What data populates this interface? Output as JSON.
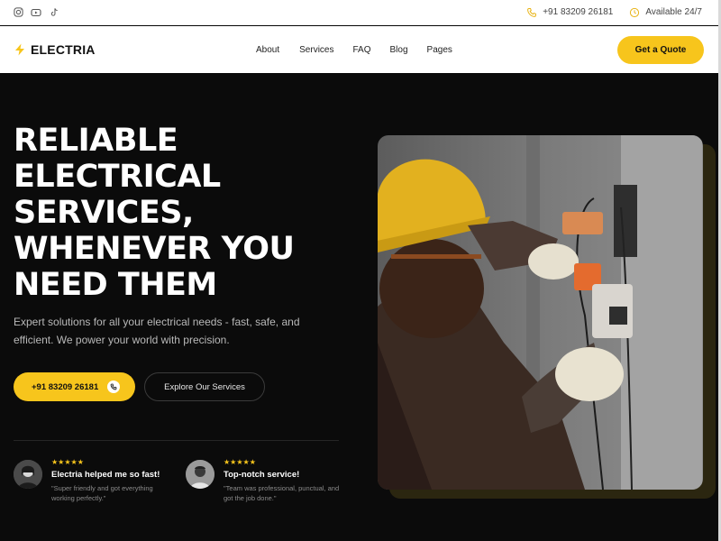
{
  "topbar": {
    "socials": [
      "instagram-icon",
      "youtube-icon",
      "tiktok-icon"
    ],
    "phone": "+91 83209 26181",
    "availability": "Available 24/7"
  },
  "nav": {
    "logo": "ELECTRIA",
    "links": [
      "About",
      "Services",
      "FAQ",
      "Blog",
      "Pages"
    ],
    "cta": "Get a Quote"
  },
  "hero": {
    "title_lines": [
      "RELIABLE",
      "ELECTRICAL",
      "SERVICES,",
      "WHENEVER YOU",
      "NEED THEM"
    ],
    "subtitle": "Expert solutions for all your electrical needs - fast, safe, and efficient. We power your world with precision.",
    "call_button": "+91 83209 26181",
    "explore_button": "Explore Our Services"
  },
  "reviews": [
    {
      "stars": "★★★★★",
      "title": "Electria helped me so fast!",
      "text": "\"Super friendly and got everything working perfectly.\""
    },
    {
      "stars": "★★★★★",
      "title": "Top-notch service!",
      "text": "\"Team was professional, punctual, and got the job done.\""
    }
  ],
  "colors": {
    "accent": "#f7c51c",
    "background": "#0b0b0b",
    "header_bg": "#ffffff"
  }
}
